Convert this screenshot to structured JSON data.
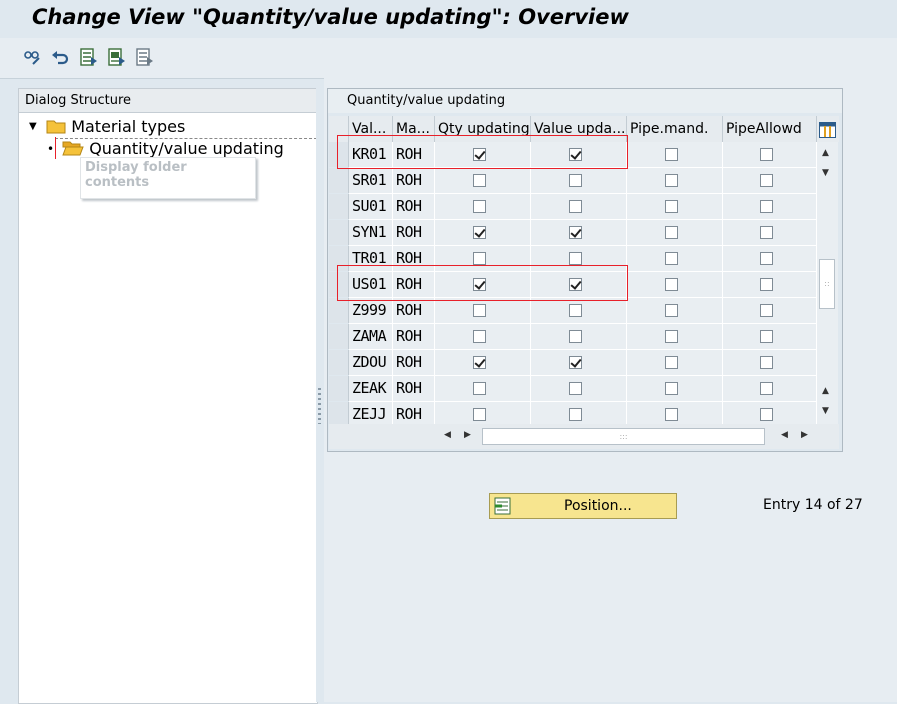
{
  "title": "Change View \"Quantity/value updating\": Overview",
  "toolbar": {
    "icons": [
      "glasses-edit-icon",
      "undo-icon",
      "select-all-icon",
      "select-block-icon",
      "deselect-all-icon"
    ]
  },
  "dialog_structure": {
    "header": "Dialog Structure",
    "items": [
      {
        "label": "Material types",
        "expanded": true
      },
      {
        "label": "Quantity/value updating",
        "selected": true
      }
    ],
    "tooltip": "Display folder contents"
  },
  "table": {
    "title": "Quantity/value updating",
    "columns": [
      "Val...",
      "Ma...",
      "Qty updating",
      "Value upda...",
      "Pipe.mand.",
      "PipeAllowd"
    ],
    "rows": [
      {
        "val": "KR01",
        "ma": "ROH",
        "qty": true,
        "value": true,
        "pipe_mand": false,
        "pipe_allowed": false
      },
      {
        "val": "SR01",
        "ma": "ROH",
        "qty": false,
        "value": false,
        "pipe_mand": false,
        "pipe_allowed": false
      },
      {
        "val": "SU01",
        "ma": "ROH",
        "qty": false,
        "value": false,
        "pipe_mand": false,
        "pipe_allowed": false
      },
      {
        "val": "SYN1",
        "ma": "ROH",
        "qty": true,
        "value": true,
        "pipe_mand": false,
        "pipe_allowed": false
      },
      {
        "val": "TR01",
        "ma": "ROH",
        "qty": false,
        "value": false,
        "pipe_mand": false,
        "pipe_allowed": false
      },
      {
        "val": "US01",
        "ma": "ROH",
        "qty": true,
        "value": true,
        "pipe_mand": false,
        "pipe_allowed": false
      },
      {
        "val": "Z999",
        "ma": "ROH",
        "qty": false,
        "value": false,
        "pipe_mand": false,
        "pipe_allowed": false
      },
      {
        "val": "ZAMA",
        "ma": "ROH",
        "qty": false,
        "value": false,
        "pipe_mand": false,
        "pipe_allowed": false
      },
      {
        "val": "ZDOU",
        "ma": "ROH",
        "qty": true,
        "value": true,
        "pipe_mand": false,
        "pipe_allowed": false
      },
      {
        "val": "ZEAK",
        "ma": "ROH",
        "qty": false,
        "value": false,
        "pipe_mand": false,
        "pipe_allowed": false
      },
      {
        "val": "ZEJJ",
        "ma": "ROH",
        "qty": false,
        "value": false,
        "pipe_mand": false,
        "pipe_allowed": false
      }
    ]
  },
  "position_button": {
    "label": "Position..."
  },
  "entry_status": "Entry 14 of 27",
  "colors": {
    "accent_red": "#e8202a",
    "button_yellow": "#f7e58f",
    "folder_yellow": "#f5c23a"
  }
}
